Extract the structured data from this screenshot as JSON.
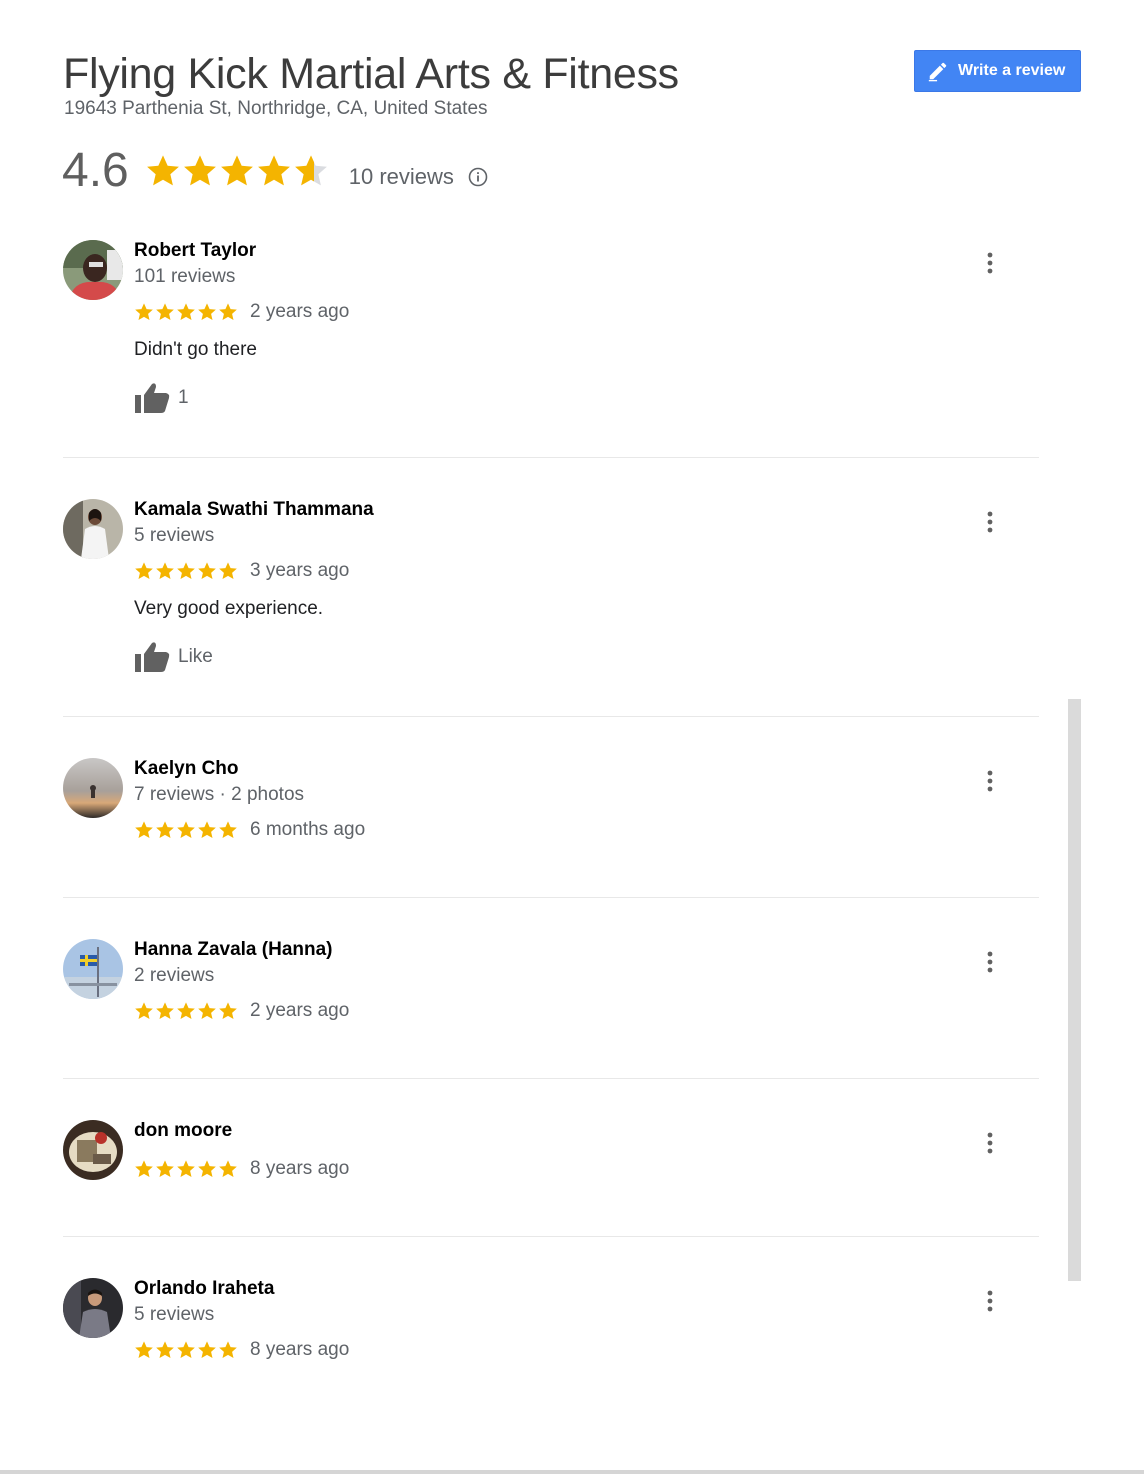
{
  "place": {
    "name": "Flying Kick Martial Arts & Fitness",
    "address": "19643 Parthenia St, Northridge, CA, United States",
    "rating": "4.6",
    "rating_value": 4.6,
    "review_count_label": "10 reviews",
    "write_review_label": "Write a review"
  },
  "colors": {
    "star": "#f4b400",
    "star_empty": "#dadce0",
    "button": "#4285f4",
    "icon": "#616161"
  },
  "icons": {
    "write": "pencil-icon",
    "info": "info-icon",
    "like": "thumb-up-icon",
    "more": "more-vert-icon"
  },
  "reviews": [
    {
      "author": "Robert Taylor",
      "meta": "101 reviews",
      "stars": 5,
      "time": "2 years ago",
      "text": "Didn't go there",
      "like_label": "1"
    },
    {
      "author": "Kamala Swathi Thammana",
      "meta": "5 reviews",
      "stars": 5,
      "time": "3 years ago",
      "text": "Very good experience.",
      "like_label": "Like"
    },
    {
      "author": "Kaelyn Cho",
      "meta": "7 reviews · 2 photos",
      "stars": 5,
      "time": "6 months ago"
    },
    {
      "author": "Hanna Zavala (Hanna)",
      "meta": "2 reviews",
      "stars": 5,
      "time": "2 years ago"
    },
    {
      "author": "don moore",
      "stars": 5,
      "time": "8 years ago"
    },
    {
      "author": "Orlando Iraheta",
      "meta": "5 reviews",
      "stars": 5,
      "time": "8 years ago"
    }
  ]
}
